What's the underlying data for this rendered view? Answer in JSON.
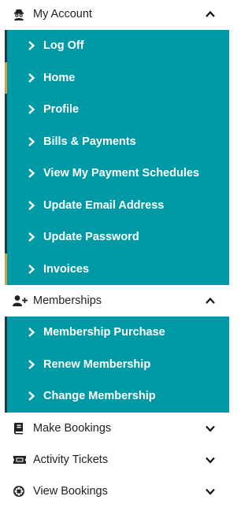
{
  "sections": {
    "my_account": {
      "label": "My Account",
      "items": [
        {
          "label": "Log Off"
        },
        {
          "label": "Home"
        },
        {
          "label": "Profile"
        },
        {
          "label": "Bills & Payments"
        },
        {
          "label": "View My Payment Schedules"
        },
        {
          "label": "Update Email Address"
        },
        {
          "label": "Update Password"
        },
        {
          "label": "Invoices"
        }
      ]
    },
    "memberships": {
      "label": "Memberships",
      "items": [
        {
          "label": "Membership Purchase"
        },
        {
          "label": "Renew Membership"
        },
        {
          "label": "Change Membership"
        }
      ]
    },
    "make_bookings": {
      "label": "Make Bookings"
    },
    "activity_tickets": {
      "label": "Activity Tickets"
    },
    "view_bookings": {
      "label": "View Bookings"
    }
  },
  "colors": {
    "menu_background": "#009aa6",
    "left_border_dark": "#1b3a4b",
    "left_border_gold": "#c8a24a",
    "text_white": "#ffffff",
    "text_dark": "#222222"
  },
  "icons": {
    "my_account": "incognito-user-icon",
    "memberships": "user-plus-icon",
    "make_bookings": "book-icon",
    "activity_tickets": "ticket-icon",
    "view_bookings": "cog-burst-icon",
    "expand_open": "chevron-up-icon",
    "expand_closed": "chevron-down-icon",
    "item_arrow": "chevron-right-icon"
  }
}
